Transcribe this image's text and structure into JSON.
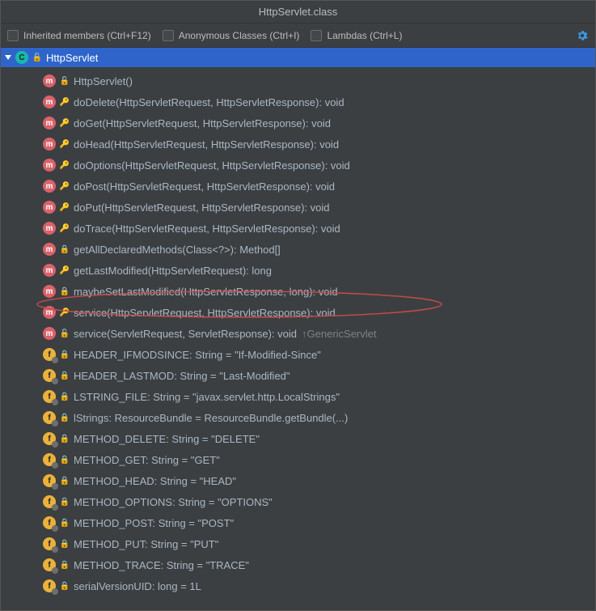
{
  "title": "HttpServlet.class",
  "toolbar": {
    "inherited": "Inherited members (Ctrl+F12)",
    "anonymous": "Anonymous Classes (Ctrl+I)",
    "lambdas": "Lambdas (Ctrl+L)"
  },
  "className": "HttpServlet",
  "members": [
    {
      "kind": "m",
      "vis": "open",
      "sig": "HttpServlet()"
    },
    {
      "kind": "m",
      "vis": "key",
      "sig": "doDelete(HttpServletRequest, HttpServletResponse): void"
    },
    {
      "kind": "m",
      "vis": "key",
      "sig": "doGet(HttpServletRequest, HttpServletResponse): void"
    },
    {
      "kind": "m",
      "vis": "key",
      "sig": "doHead(HttpServletRequest, HttpServletResponse): void"
    },
    {
      "kind": "m",
      "vis": "key",
      "sig": "doOptions(HttpServletRequest, HttpServletResponse): void"
    },
    {
      "kind": "m",
      "vis": "key",
      "sig": "doPost(HttpServletRequest, HttpServletResponse): void"
    },
    {
      "kind": "m",
      "vis": "key",
      "sig": "doPut(HttpServletRequest, HttpServletResponse): void"
    },
    {
      "kind": "m",
      "vis": "key",
      "sig": "doTrace(HttpServletRequest, HttpServletResponse): void"
    },
    {
      "kind": "m",
      "vis": "lock",
      "sig": "getAllDeclaredMethods(Class<?>): Method[]"
    },
    {
      "kind": "m",
      "vis": "key",
      "sig": "getLastModified(HttpServletRequest): long"
    },
    {
      "kind": "m",
      "vis": "lock",
      "sig": "maybeSetLastModified(HttpServletResponse, long): void"
    },
    {
      "kind": "m",
      "vis": "key",
      "sig": "service(HttpServletRequest, HttpServletResponse): void"
    },
    {
      "kind": "m",
      "vis": "open",
      "sig": "service(ServletRequest, ServletResponse): void",
      "inherit": "↑GenericServlet"
    },
    {
      "kind": "f",
      "vis": "lock",
      "sig": "HEADER_IFMODSINCE: String = \"If-Modified-Since\""
    },
    {
      "kind": "f",
      "vis": "lock",
      "sig": "HEADER_LASTMOD: String = \"Last-Modified\""
    },
    {
      "kind": "f",
      "vis": "lock",
      "sig": "LSTRING_FILE: String = \"javax.servlet.http.LocalStrings\""
    },
    {
      "kind": "f",
      "vis": "lock",
      "sig": "lStrings: ResourceBundle = ResourceBundle.getBundle(...)"
    },
    {
      "kind": "f",
      "vis": "lock",
      "sig": "METHOD_DELETE: String = \"DELETE\""
    },
    {
      "kind": "f",
      "vis": "lock",
      "sig": "METHOD_GET: String = \"GET\""
    },
    {
      "kind": "f",
      "vis": "lock",
      "sig": "METHOD_HEAD: String = \"HEAD\""
    },
    {
      "kind": "f",
      "vis": "lock",
      "sig": "METHOD_OPTIONS: String = \"OPTIONS\""
    },
    {
      "kind": "f",
      "vis": "lock",
      "sig": "METHOD_POST: String = \"POST\""
    },
    {
      "kind": "f",
      "vis": "lock",
      "sig": "METHOD_PUT: String = \"PUT\""
    },
    {
      "kind": "f",
      "vis": "lock",
      "sig": "METHOD_TRACE: String = \"TRACE\""
    },
    {
      "kind": "f",
      "vis": "lock",
      "sig": "serialVersionUID: long = 1L"
    }
  ],
  "icons": {
    "m": "m",
    "f": "f",
    "c": "C"
  },
  "visGlyph": {
    "lock": "🔒",
    "open": "🔓",
    "key": "🔑"
  }
}
